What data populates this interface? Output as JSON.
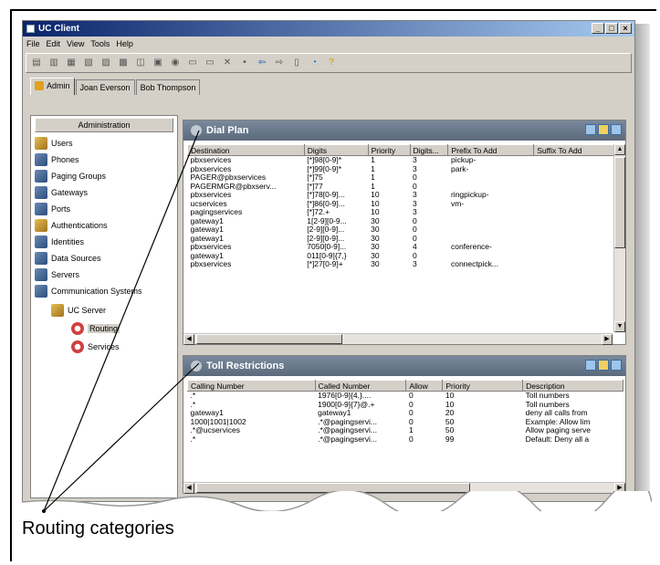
{
  "window": {
    "title": "UC Client"
  },
  "menu": [
    "File",
    "Edit",
    "View",
    "Tools",
    "Help"
  ],
  "tabs": [
    "Admin",
    "Joan Everson",
    "Bob Thompson"
  ],
  "left_panel": {
    "header": "Administration",
    "items": [
      "Users",
      "Phones",
      "Paging Groups",
      "Gateways",
      "Ports",
      "Authentications",
      "Identities",
      "Data Sources",
      "Servers",
      "Communication Systems",
      "UC Server",
      "Routing",
      "Services"
    ]
  },
  "dial_plan": {
    "title": "Dial Plan",
    "columns": [
      "Destination",
      "Digits",
      "Priority",
      "Digits...",
      "Prefix To Add",
      "Suffix To Add"
    ],
    "rows": [
      [
        "pbxservices",
        "[*]98[0-9]*",
        "1",
        "3",
        "pickup-",
        ""
      ],
      [
        "pbxservices",
        "[*]99[0-9]*",
        "1",
        "3",
        "park-",
        ""
      ],
      [
        "PAGER@pbxservices",
        "[*]75",
        "1",
        "0",
        "",
        ""
      ],
      [
        "PAGERMGR@pbxserv...",
        "[*]77",
        "1",
        "0",
        "",
        ""
      ],
      [
        "pbxservices",
        "[*]78[0-9]...",
        "10",
        "3",
        "ringpickup-",
        ""
      ],
      [
        "ucservices",
        "[*]86[0-9]...",
        "10",
        "3",
        "vm-",
        ""
      ],
      [
        "pagingservices",
        "[*]72.+",
        "10",
        "3",
        "",
        ""
      ],
      [
        "gateway1",
        "1[2-9][0-9...",
        "30",
        "0",
        "",
        ""
      ],
      [
        "gateway1",
        "[2-9][0-9]...",
        "30",
        "0",
        "",
        ""
      ],
      [
        "gateway1",
        "[2-9][0-9]...",
        "30",
        "0",
        "",
        ""
      ],
      [
        "pbxservices",
        "7050[0-9]...",
        "30",
        "4",
        "conference-",
        ""
      ],
      [
        "gateway1",
        "011[0-9]{7,}",
        "30",
        "0",
        "",
        ""
      ],
      [
        "pbxservices",
        "[*]27[0-9]+",
        "30",
        "3",
        "connectpick...",
        ""
      ]
    ]
  },
  "toll": {
    "title": "Toll Restrictions",
    "columns": [
      "Calling Number",
      "Called Number",
      "Allow",
      "Priority",
      "Description"
    ],
    "rows": [
      [
        ".*",
        "1976[0-9]{4,}....",
        "0",
        "10",
        "Toll numbers"
      ],
      [
        ".*",
        "1900[0-9]{7}@.+",
        "0",
        "10",
        "Toll numbers"
      ],
      [
        "gateway1",
        "gateway1",
        "0",
        "20",
        "deny all calls from"
      ],
      [
        "1000|1001|1002",
        ".*@pagingservi...",
        "0",
        "50",
        "Example: Allow lim"
      ],
      [
        ".*@ucservices",
        ".*@pagingservi...",
        "1",
        "50",
        "Allow paging serve"
      ],
      [
        ".*",
        ".*@pagingservi...",
        "0",
        "99",
        "Default: Deny all a"
      ]
    ]
  },
  "caption": "Routing categories",
  "colors": {
    "panel_title": "#5a6a7c",
    "titlebar": "#0a246a"
  }
}
